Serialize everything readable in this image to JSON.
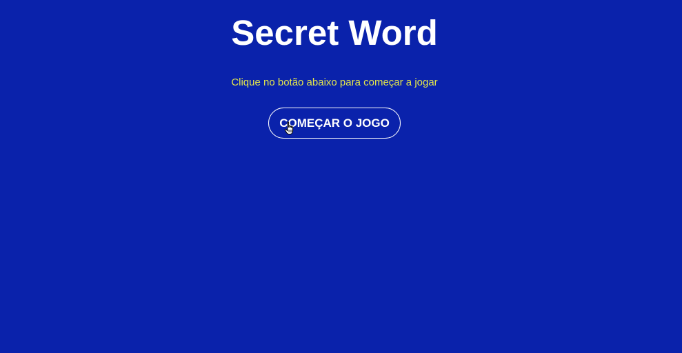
{
  "page": {
    "title": "Secret Word",
    "subtitle": "Clique no botão abaixo para começar a jogar",
    "start_button_label": "COMEÇAR O JOGO"
  },
  "colors": {
    "background": "#0a22ab",
    "title": "#ffffff",
    "subtitle": "#e6e84a",
    "button_border": "#ffffff"
  },
  "icons": {
    "cursor": "hand-pointer-icon"
  }
}
